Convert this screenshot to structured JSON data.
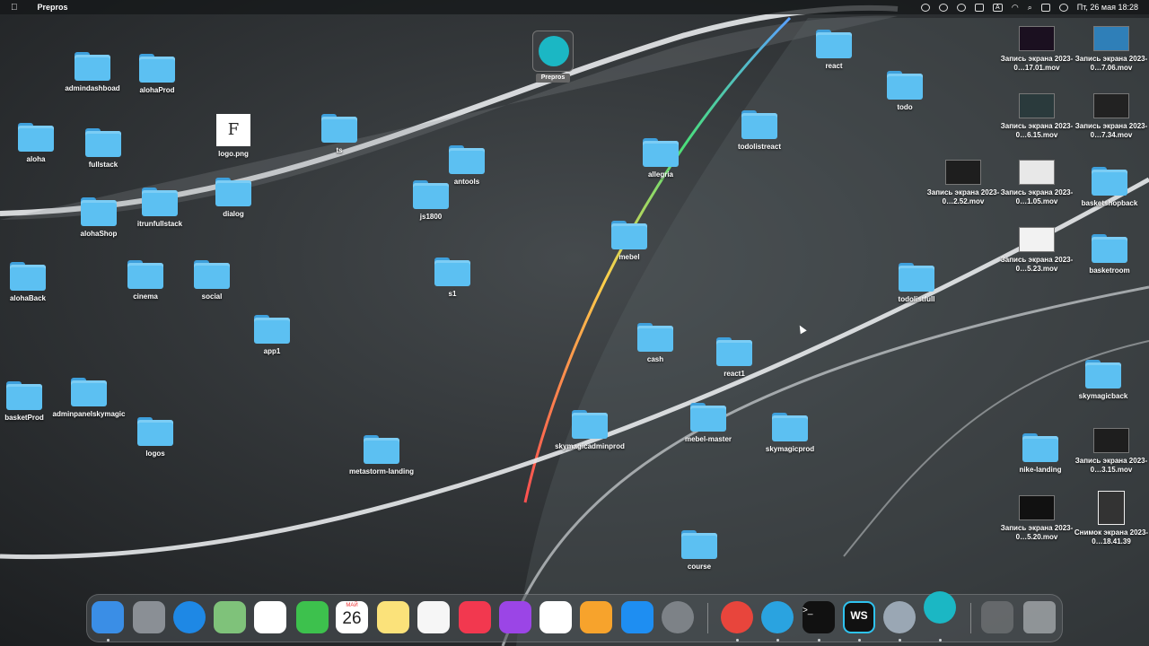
{
  "menubar": {
    "apple_icon": "apple-logo",
    "app_name": "Prepros",
    "input_lang": "A",
    "datetime": "Пт, 26 мая  18:28"
  },
  "desktop_items": [
    {
      "label": "admindashboad",
      "type": "folder"
    },
    {
      "label": "alohaProd",
      "type": "folder"
    },
    {
      "label": "aloha",
      "type": "folder"
    },
    {
      "label": "fullstack",
      "type": "folder"
    },
    {
      "label": "logo.png",
      "type": "image-file"
    },
    {
      "label": "ts",
      "type": "folder"
    },
    {
      "label": "antools",
      "type": "folder"
    },
    {
      "label": "js1800",
      "type": "folder"
    },
    {
      "label": "alohaShop",
      "type": "folder"
    },
    {
      "label": "itrunfullstack",
      "type": "folder"
    },
    {
      "label": "dialog",
      "type": "folder"
    },
    {
      "label": "alohaBack",
      "type": "folder"
    },
    {
      "label": "cinema",
      "type": "folder"
    },
    {
      "label": "social",
      "type": "folder"
    },
    {
      "label": "s1",
      "type": "folder"
    },
    {
      "label": "app1",
      "type": "folder"
    },
    {
      "label": "basketProd",
      "type": "folder"
    },
    {
      "label": "adminpanelskymagic",
      "type": "folder"
    },
    {
      "label": "logos",
      "type": "folder"
    },
    {
      "label": "metastorm-landing",
      "type": "folder"
    },
    {
      "label": "react",
      "type": "folder"
    },
    {
      "label": "todo",
      "type": "folder"
    },
    {
      "label": "todolistreact",
      "type": "folder"
    },
    {
      "label": "allegria",
      "type": "folder"
    },
    {
      "label": "mebel",
      "type": "folder"
    },
    {
      "label": "todolistfull",
      "type": "folder"
    },
    {
      "label": "cash",
      "type": "folder"
    },
    {
      "label": "react1",
      "type": "folder"
    },
    {
      "label": "skymagicadminprod",
      "type": "folder"
    },
    {
      "label": "mebel-master",
      "type": "folder"
    },
    {
      "label": "skymagicprod",
      "type": "folder"
    },
    {
      "label": "course",
      "type": "folder"
    },
    {
      "label": "Запись экрана 2023-0…17.01.mov",
      "type": "video"
    },
    {
      "label": "Запись экрана 2023-0…7.06.mov",
      "type": "video"
    },
    {
      "label": "Запись экрана 2023-0…6.15.mov",
      "type": "video"
    },
    {
      "label": "Запись экрана 2023-0…7.34.mov",
      "type": "video"
    },
    {
      "label": "Запись экрана 2023-0…2.52.mov",
      "type": "video"
    },
    {
      "label": "Запись экрана 2023-0…1.05.mov",
      "type": "video"
    },
    {
      "label": "basketshopback",
      "type": "folder"
    },
    {
      "label": "Запись экрана 2023-0…5.23.mov",
      "type": "video"
    },
    {
      "label": "basketroom",
      "type": "folder"
    },
    {
      "label": "skymagicback",
      "type": "folder"
    },
    {
      "label": "nike-landing",
      "type": "folder"
    },
    {
      "label": "Запись экрана 2023-0…3.15.mov",
      "type": "video"
    },
    {
      "label": "Запись экрана 2023-0…5.20.mov",
      "type": "video"
    },
    {
      "label": "Снимок экрана 2023-0…18.41.39",
      "type": "screenshot"
    }
  ],
  "prepros_app": {
    "label": "Prepros",
    "icon": "prepros-icon"
  },
  "logo_file_glyph": "F",
  "dock": {
    "apps": [
      "Finder",
      "Launchpad",
      "Safari",
      "Maps",
      "Photos",
      "FaceTime",
      "Calendar",
      "Notes",
      "Freeform",
      "Music",
      "Podcasts",
      "Numbers",
      "Pages",
      "App Store",
      "System Settings",
      "Chrome",
      "Telegram",
      "Terminal",
      "WebStorm",
      "QuickTime Player",
      "Prepros",
      "Downloads",
      "Trash"
    ],
    "calendar": {
      "month": "МАЙ",
      "day": "26"
    },
    "terminal_glyph": ">_",
    "webstorm_glyph": "WS"
  },
  "colors": {
    "folder": "#5cc0f2",
    "folder_tab": "#3ea0dc",
    "prepros": "#1bb7c4"
  }
}
